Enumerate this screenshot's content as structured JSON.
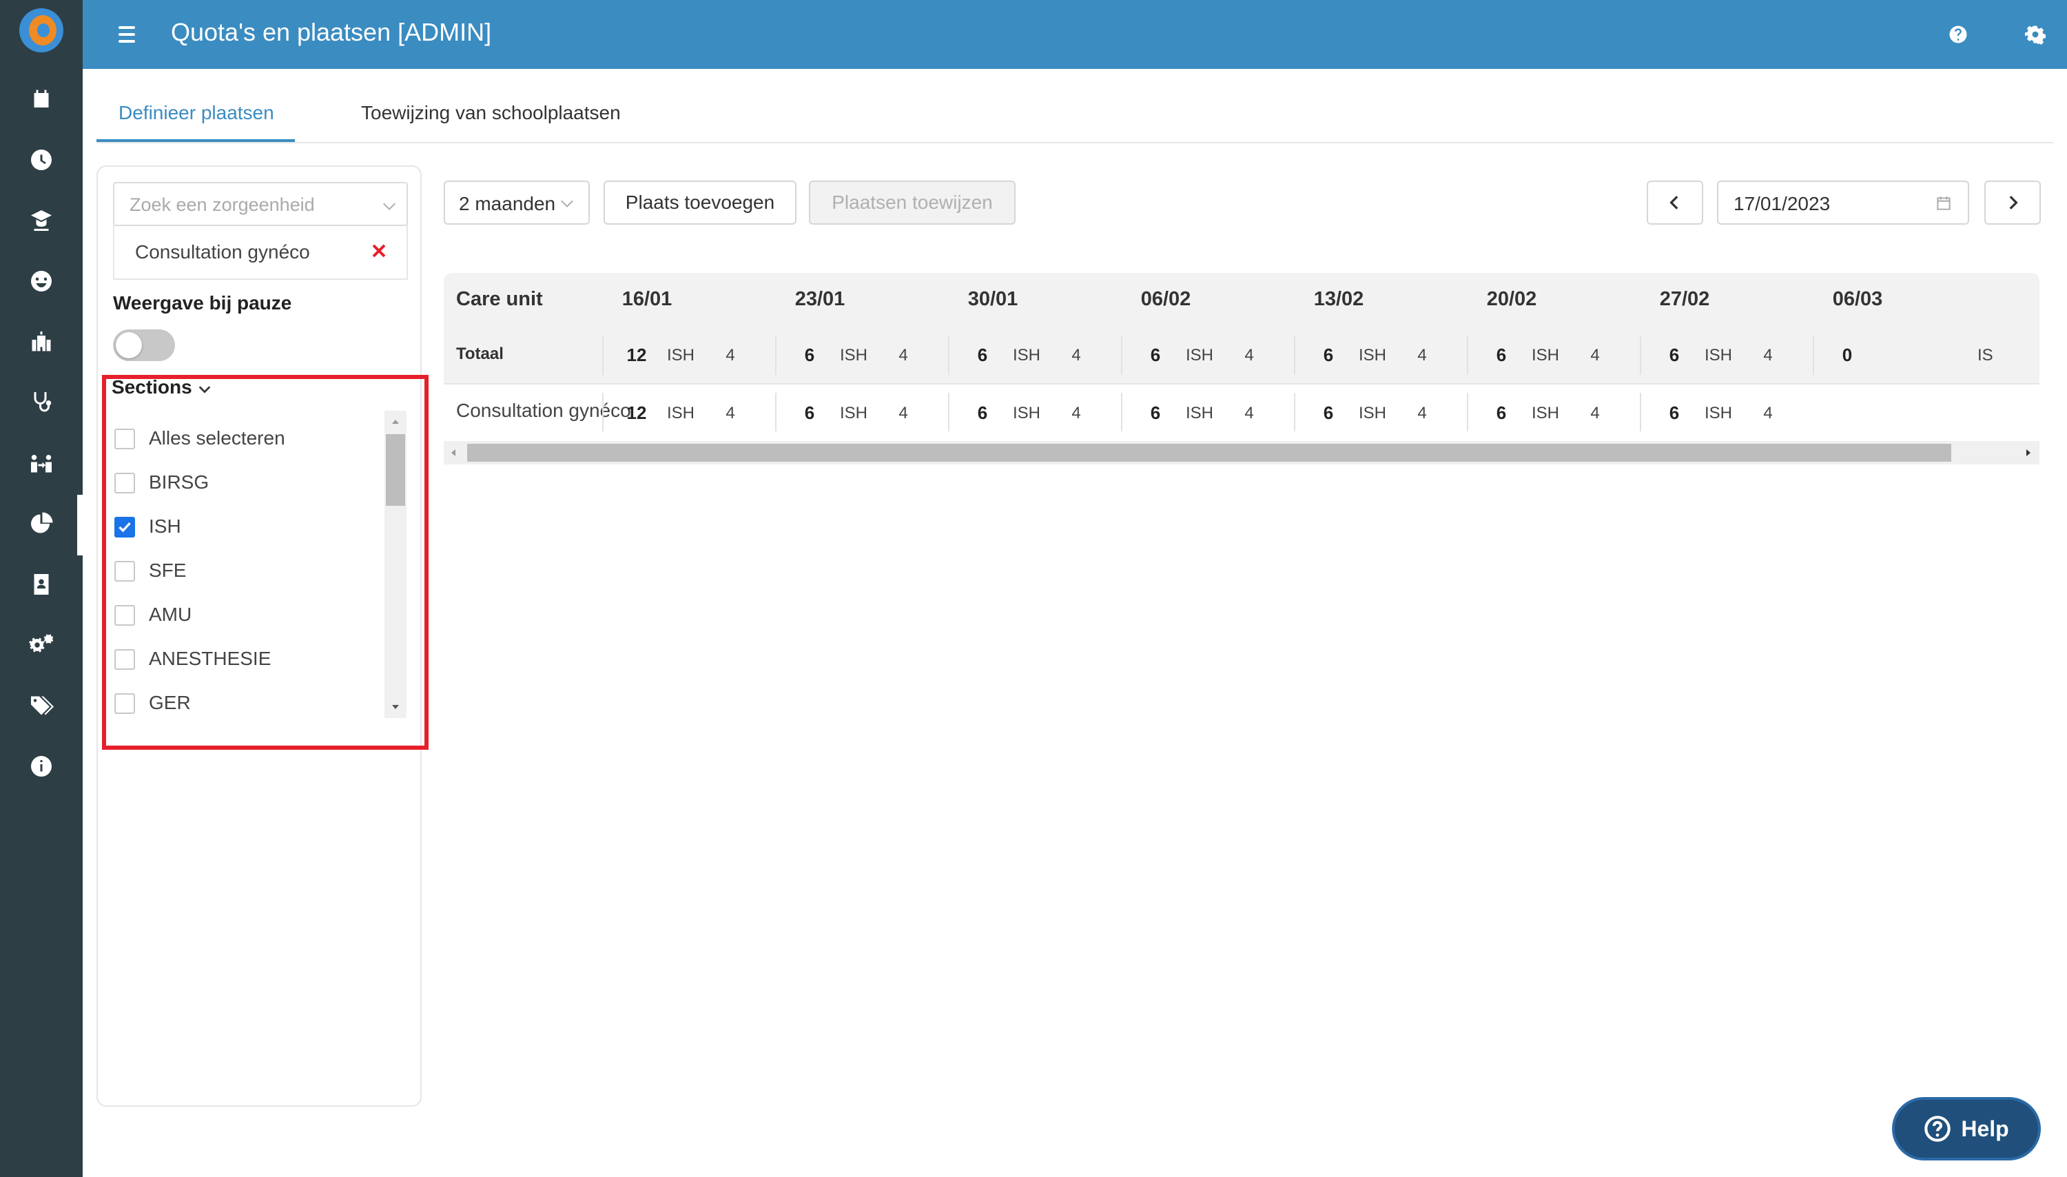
{
  "app": {
    "title": "Quota's en plaatsen [ADMIN]"
  },
  "sidebar": {
    "items": [
      {
        "icon": "calendar-icon"
      },
      {
        "icon": "clock-icon"
      },
      {
        "icon": "student-icon"
      },
      {
        "icon": "smiley-icon"
      },
      {
        "icon": "building-icon"
      },
      {
        "icon": "stethoscope-icon"
      },
      {
        "icon": "users-swap-icon"
      },
      {
        "icon": "pie-chart-icon",
        "active": true
      },
      {
        "icon": "id-card-icon"
      },
      {
        "icon": "gears-icon"
      },
      {
        "icon": "tags-icon"
      },
      {
        "icon": "info-icon"
      }
    ]
  },
  "header": {
    "help_icon": "question-circle-icon",
    "settings_icon": "gear-icon"
  },
  "tabs": [
    {
      "label": "Definieer plaatsen",
      "active": true
    },
    {
      "label": "Toewijzing van schoolplaatsen",
      "active": false
    }
  ],
  "filters": {
    "care_unit_search": {
      "placeholder": "Zoek een zorgeenheid"
    },
    "selected_unit": "Consultation gynéco",
    "pause_label": "Weergave bij pauze",
    "pause_toggle_on": false,
    "sections_label": "Sections",
    "sections": [
      {
        "label": "Alles selecteren",
        "checked": false
      },
      {
        "label": "BIRSG",
        "checked": false
      },
      {
        "label": "ISH",
        "checked": true
      },
      {
        "label": "SFE",
        "checked": false
      },
      {
        "label": "AMU",
        "checked": false
      },
      {
        "label": "ANESTHESIE",
        "checked": false
      },
      {
        "label": "GER",
        "checked": false
      }
    ]
  },
  "toolbar": {
    "period": "2 maanden",
    "add_place": "Plaats toevoegen",
    "assign_places": "Plaatsen toewijzen",
    "date": "17/01/2023"
  },
  "table": {
    "care_unit_header": "Care unit",
    "dates": [
      "16/01",
      "23/01",
      "30/01",
      "06/02",
      "13/02",
      "20/02",
      "27/02",
      "06/03"
    ],
    "total_label": "Totaal",
    "total_row": {
      "numbers": [
        "12",
        "6",
        "6",
        "6",
        "6",
        "6",
        "6",
        "0"
      ],
      "section": "ISH",
      "values": [
        "4",
        "4",
        "4",
        "4",
        "4",
        "4",
        "4"
      ],
      "trailing": "IS"
    },
    "rows": [
      {
        "label": "Consultation gynéco",
        "numbers": [
          "12",
          "6",
          "6",
          "6",
          "6",
          "6",
          "6"
        ],
        "section": "ISH",
        "values": [
          "4",
          "4",
          "4",
          "4",
          "4",
          "4",
          "4"
        ]
      }
    ]
  },
  "help_button": {
    "label": "Help"
  }
}
